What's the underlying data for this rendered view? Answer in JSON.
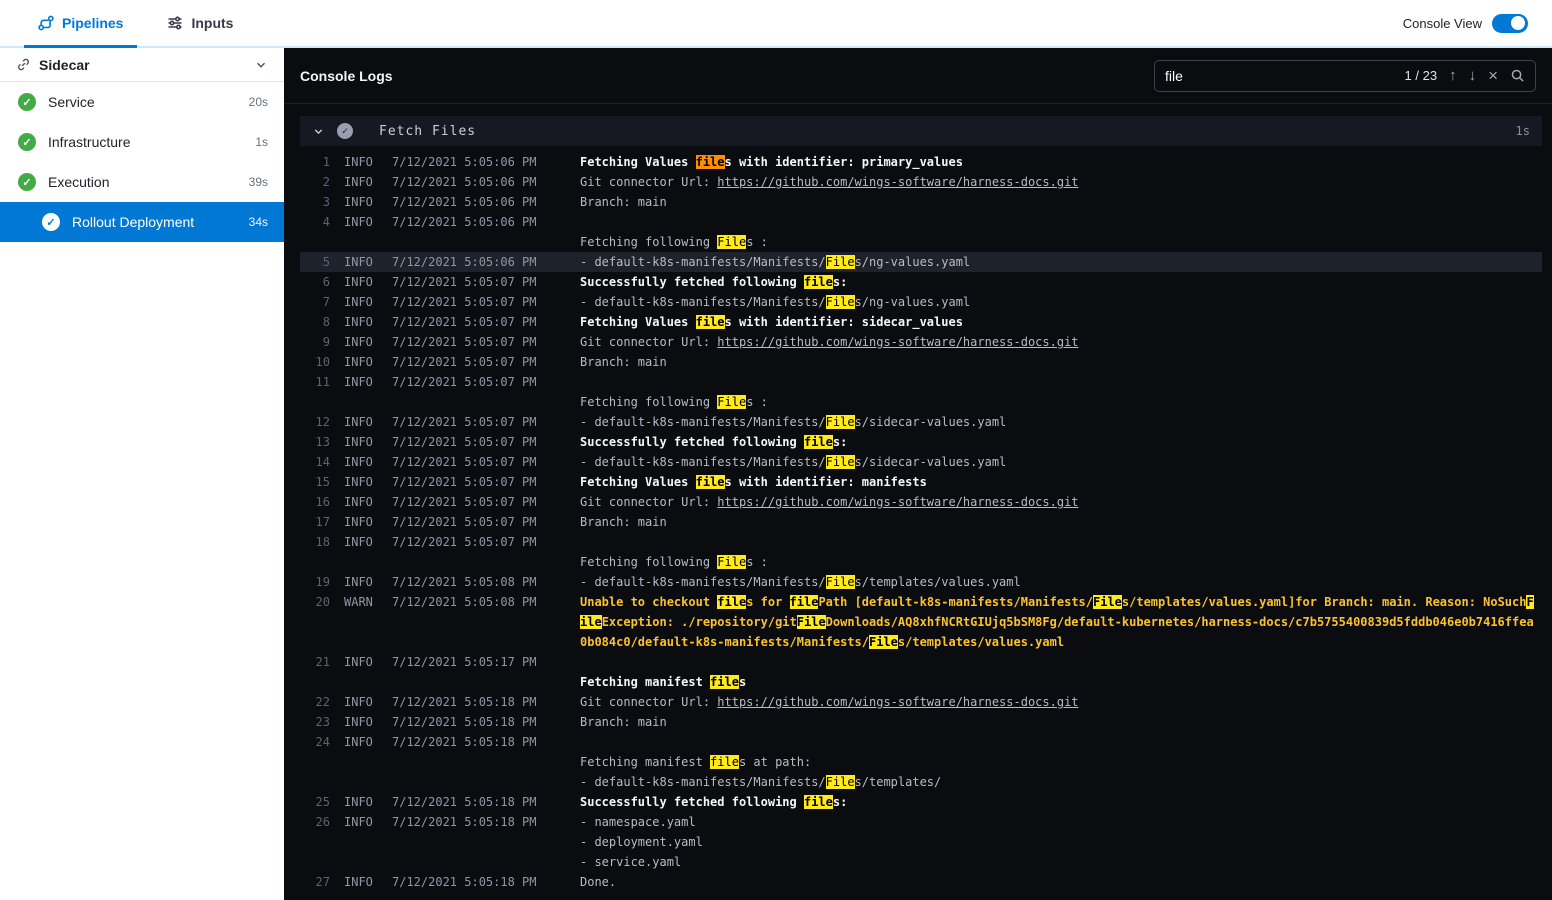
{
  "topbar": {
    "tabs": [
      {
        "label": "Pipelines",
        "active": true
      },
      {
        "label": "Inputs",
        "active": false
      }
    ],
    "console_view": {
      "label": "Console View",
      "enabled": true
    }
  },
  "sidebar": {
    "group_label": "Sidecar",
    "items": [
      {
        "label": "Service",
        "duration": "20s",
        "status": "success",
        "indent": 1,
        "selected": false
      },
      {
        "label": "Infrastructure",
        "duration": "1s",
        "status": "success",
        "indent": 1,
        "selected": false
      },
      {
        "label": "Execution",
        "duration": "39s",
        "status": "success",
        "indent": 1,
        "selected": false
      },
      {
        "label": "Rollout Deployment",
        "duration": "34s",
        "status": "success",
        "indent": 2,
        "selected": true
      }
    ]
  },
  "console": {
    "title": "Console Logs",
    "search": {
      "value": "file",
      "counter": "1 / 23"
    },
    "section": {
      "title": "Fetch Files",
      "duration": "1s",
      "status": "success"
    },
    "colors": {
      "accent": "#0278d5",
      "success": "#42ab45",
      "warn_text": "#fcc22d",
      "match_highlight": "#ffe920",
      "current_match_highlight": "#ff8f00"
    },
    "logs": [
      {
        "n": "1",
        "level": "INFO",
        "ts": "7/12/2021 5:05:06 PM",
        "rows": [
          [
            {
              "t": "Fetching Values ",
              "b": true
            },
            {
              "t": "file",
              "b": true,
              "h": "o"
            },
            {
              "t": "s with identifier: primary_values",
              "b": true
            }
          ]
        ]
      },
      {
        "n": "2",
        "level": "INFO",
        "ts": "7/12/2021 5:05:06 PM",
        "rows": [
          [
            {
              "t": "Git connector Url: "
            },
            {
              "t": "https://github.com/wings-software/harness-docs.git",
              "u": true
            }
          ]
        ]
      },
      {
        "n": "3",
        "level": "INFO",
        "ts": "7/12/2021 5:05:06 PM",
        "rows": [
          [
            {
              "t": "Branch: main"
            }
          ]
        ]
      },
      {
        "n": "4",
        "level": "INFO",
        "ts": "7/12/2021 5:05:06 PM",
        "rows": [
          [],
          [
            {
              "t": "Fetching following "
            },
            {
              "t": "File",
              "h": "y"
            },
            {
              "t": "s :"
            }
          ]
        ]
      },
      {
        "n": "5",
        "level": "INFO",
        "ts": "7/12/2021 5:05:06 PM",
        "sel": true,
        "rows": [
          [
            {
              "t": "- default-k8s-manifests/Manifests/"
            },
            {
              "t": "File",
              "h": "y"
            },
            {
              "t": "s/ng-values.yaml"
            }
          ]
        ]
      },
      {
        "n": "6",
        "level": "INFO",
        "ts": "7/12/2021 5:05:07 PM",
        "rows": [
          [
            {
              "t": "Successfully fetched following ",
              "b": true
            },
            {
              "t": "file",
              "b": true,
              "h": "y"
            },
            {
              "t": "s:",
              "b": true
            }
          ]
        ]
      },
      {
        "n": "7",
        "level": "INFO",
        "ts": "7/12/2021 5:05:07 PM",
        "rows": [
          [
            {
              "t": "- default-k8s-manifests/Manifests/"
            },
            {
              "t": "File",
              "h": "y"
            },
            {
              "t": "s/ng-values.yaml"
            }
          ]
        ]
      },
      {
        "n": "8",
        "level": "INFO",
        "ts": "7/12/2021 5:05:07 PM",
        "rows": [
          [
            {
              "t": "Fetching Values ",
              "b": true
            },
            {
              "t": "file",
              "b": true,
              "h": "y"
            },
            {
              "t": "s with identifier: sidecar_values",
              "b": true
            }
          ]
        ]
      },
      {
        "n": "9",
        "level": "INFO",
        "ts": "7/12/2021 5:05:07 PM",
        "rows": [
          [
            {
              "t": "Git connector Url: "
            },
            {
              "t": "https://github.com/wings-software/harness-docs.git",
              "u": true
            }
          ]
        ]
      },
      {
        "n": "10",
        "level": "INFO",
        "ts": "7/12/2021 5:05:07 PM",
        "rows": [
          [
            {
              "t": "Branch: main"
            }
          ]
        ]
      },
      {
        "n": "11",
        "level": "INFO",
        "ts": "7/12/2021 5:05:07 PM",
        "rows": [
          [],
          [
            {
              "t": "Fetching following "
            },
            {
              "t": "File",
              "h": "y"
            },
            {
              "t": "s :"
            }
          ]
        ]
      },
      {
        "n": "12",
        "level": "INFO",
        "ts": "7/12/2021 5:05:07 PM",
        "rows": [
          [
            {
              "t": "- default-k8s-manifests/Manifests/"
            },
            {
              "t": "File",
              "h": "y"
            },
            {
              "t": "s/sidecar-values.yaml"
            }
          ]
        ]
      },
      {
        "n": "13",
        "level": "INFO",
        "ts": "7/12/2021 5:05:07 PM",
        "rows": [
          [
            {
              "t": "Successfully fetched following ",
              "b": true
            },
            {
              "t": "file",
              "b": true,
              "h": "y"
            },
            {
              "t": "s:",
              "b": true
            }
          ]
        ]
      },
      {
        "n": "14",
        "level": "INFO",
        "ts": "7/12/2021 5:05:07 PM",
        "rows": [
          [
            {
              "t": "- default-k8s-manifests/Manifests/"
            },
            {
              "t": "File",
              "h": "y"
            },
            {
              "t": "s/sidecar-values.yaml"
            }
          ]
        ]
      },
      {
        "n": "15",
        "level": "INFO",
        "ts": "7/12/2021 5:05:07 PM",
        "rows": [
          [
            {
              "t": "Fetching Values ",
              "b": true
            },
            {
              "t": "file",
              "b": true,
              "h": "y"
            },
            {
              "t": "s with identifier: manifests",
              "b": true
            }
          ]
        ]
      },
      {
        "n": "16",
        "level": "INFO",
        "ts": "7/12/2021 5:05:07 PM",
        "rows": [
          [
            {
              "t": "Git connector Url: "
            },
            {
              "t": "https://github.com/wings-software/harness-docs.git",
              "u": true
            }
          ]
        ]
      },
      {
        "n": "17",
        "level": "INFO",
        "ts": "7/12/2021 5:05:07 PM",
        "rows": [
          [
            {
              "t": "Branch: main"
            }
          ]
        ]
      },
      {
        "n": "18",
        "level": "INFO",
        "ts": "7/12/2021 5:05:07 PM",
        "rows": [
          [],
          [
            {
              "t": "Fetching following "
            },
            {
              "t": "File",
              "h": "y"
            },
            {
              "t": "s :"
            }
          ]
        ]
      },
      {
        "n": "19",
        "level": "INFO",
        "ts": "7/12/2021 5:05:08 PM",
        "rows": [
          [
            {
              "t": "- default-k8s-manifests/Manifests/"
            },
            {
              "t": "File",
              "h": "y"
            },
            {
              "t": "s/templates/values.yaml"
            }
          ]
        ]
      },
      {
        "n": "20",
        "level": "WARN",
        "ts": "7/12/2021 5:05:08 PM",
        "rows": [
          [
            {
              "t": "Unable to checkout ",
              "w": true
            },
            {
              "t": "file",
              "w": true,
              "h": "y"
            },
            {
              "t": "s for ",
              "w": true
            },
            {
              "t": "file",
              "w": true,
              "h": "y"
            },
            {
              "t": "Path [default-k8s-manifests/Manifests/",
              "w": true
            },
            {
              "t": "File",
              "w": true,
              "h": "y"
            },
            {
              "t": "s/templates/values.yaml]for Branch: main. Reason: NoSuch",
              "w": true
            },
            {
              "t": "F",
              "w": true,
              "h": "y"
            }
          ],
          [
            {
              "t": "ile",
              "w": true,
              "h": "y"
            },
            {
              "t": "Exception: ./repository/git",
              "w": true
            },
            {
              "t": "File",
              "w": true,
              "h": "y"
            },
            {
              "t": "Downloads/AQ8xhfNCRtGIUjq5bSM8Fg/default-kubernetes/harness-docs/c7b5755400839d5fddb046e0b7416ffea",
              "w": true
            }
          ],
          [
            {
              "t": "0b084c0/default-k8s-manifests/Manifests/",
              "w": true
            },
            {
              "t": "File",
              "w": true,
              "h": "y"
            },
            {
              "t": "s/templates/values.yaml",
              "w": true
            }
          ]
        ]
      },
      {
        "n": "21",
        "level": "INFO",
        "ts": "7/12/2021 5:05:17 PM",
        "rows": [
          [],
          [
            {
              "t": "Fetching manifest ",
              "b": true
            },
            {
              "t": "file",
              "b": true,
              "h": "y"
            },
            {
              "t": "s",
              "b": true
            }
          ]
        ]
      },
      {
        "n": "22",
        "level": "INFO",
        "ts": "7/12/2021 5:05:18 PM",
        "rows": [
          [
            {
              "t": "Git connector Url: "
            },
            {
              "t": "https://github.com/wings-software/harness-docs.git",
              "u": true
            }
          ]
        ]
      },
      {
        "n": "23",
        "level": "INFO",
        "ts": "7/12/2021 5:05:18 PM",
        "rows": [
          [
            {
              "t": "Branch: main"
            }
          ]
        ]
      },
      {
        "n": "24",
        "level": "INFO",
        "ts": "7/12/2021 5:05:18 PM",
        "rows": [
          [],
          [
            {
              "t": "Fetching manifest "
            },
            {
              "t": "file",
              "h": "y"
            },
            {
              "t": "s at path:"
            }
          ],
          [
            {
              "t": "- default-k8s-manifests/Manifests/"
            },
            {
              "t": "File",
              "h": "y"
            },
            {
              "t": "s/templates/"
            }
          ]
        ]
      },
      {
        "n": "25",
        "level": "INFO",
        "ts": "7/12/2021 5:05:18 PM",
        "rows": [
          [
            {
              "t": "Successfully fetched following ",
              "b": true
            },
            {
              "t": "file",
              "b": true,
              "h": "y"
            },
            {
              "t": "s:",
              "b": true
            }
          ]
        ]
      },
      {
        "n": "26",
        "level": "INFO",
        "ts": "7/12/2021 5:05:18 PM",
        "rows": [
          [
            {
              "t": "- namespace.yaml"
            }
          ],
          [
            {
              "t": "- deployment.yaml"
            }
          ],
          [
            {
              "t": "- service.yaml"
            }
          ]
        ]
      },
      {
        "n": "27",
        "level": "INFO",
        "ts": "7/12/2021 5:05:18 PM",
        "rows": [
          [
            {
              "t": "Done."
            }
          ]
        ]
      }
    ]
  }
}
